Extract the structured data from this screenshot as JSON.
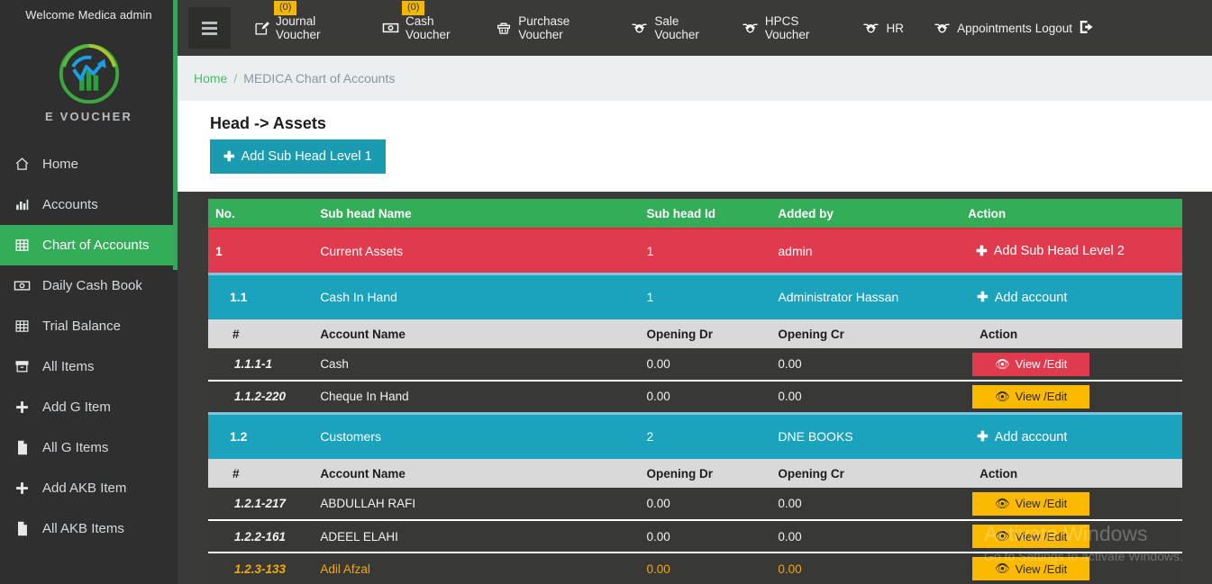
{
  "sidebar": {
    "welcome": "Welcome Medica admin",
    "logo_text": "E VOUCHER",
    "items": [
      {
        "label": "Home",
        "icon": "home-icon",
        "active": false
      },
      {
        "label": "Accounts",
        "icon": "bar-chart-icon",
        "active": false
      },
      {
        "label": "Chart of Accounts",
        "icon": "grid-icon",
        "active": true
      },
      {
        "label": "Daily Cash Book",
        "icon": "money-icon",
        "active": false
      },
      {
        "label": "Trial Balance",
        "icon": "grid-icon",
        "active": false
      },
      {
        "label": "All Items",
        "icon": "archive-icon",
        "active": false
      },
      {
        "label": "Add G Item",
        "icon": "plus-icon",
        "active": false
      },
      {
        "label": "All G Items",
        "icon": "file-icon",
        "active": false
      },
      {
        "label": "Add AKB Item",
        "icon": "plus-icon",
        "active": false
      },
      {
        "label": "All AKB Items",
        "icon": "file-icon",
        "active": false
      }
    ]
  },
  "topbar": {
    "menu_toggle": "hamburger-icon",
    "items": [
      {
        "label": "Journal Voucher",
        "icon": "edit-square-icon",
        "badge": "(0)"
      },
      {
        "label": "Cash Voucher",
        "icon": "money-icon",
        "badge": "(0)"
      },
      {
        "label": "Purchase Voucher",
        "icon": "basket-icon",
        "badge": ""
      },
      {
        "label": "Sale Voucher",
        "icon": "handshake-icon",
        "badge": ""
      },
      {
        "label": "HPCS Voucher",
        "icon": "handshake-icon",
        "badge": ""
      },
      {
        "label": "HR",
        "icon": "handshake-icon",
        "badge": ""
      },
      {
        "label": "Appointments",
        "icon": "handshake-icon",
        "badge": ""
      }
    ],
    "logout_label": "Logout"
  },
  "breadcrumb": {
    "home": "Home",
    "separator": "/",
    "current": "MEDICA Chart of Accounts"
  },
  "page": {
    "title": "Head -> Assets",
    "add_sub_head_label": "Add Sub Head Level 1"
  },
  "table": {
    "head_columns": [
      "No.",
      "Sub head Name",
      "Sub head Id",
      "Added by",
      "Action"
    ],
    "account_columns": [
      "#",
      "Account Name",
      "Opening Dr",
      "Opening Cr",
      "Action"
    ],
    "rows": {
      "level1": {
        "no": "1",
        "name": "Current Assets",
        "id": "1",
        "added_by": "admin",
        "action": "Add Sub Head Level 2"
      },
      "group1": {
        "no": "1.1",
        "name": "Cash In Hand",
        "id": "1",
        "added_by": "Administrator Hassan",
        "action": "Add account"
      },
      "group1_accounts": [
        {
          "no": "1.1.1-1",
          "name": "Cash",
          "dr": "0.00",
          "cr": "0.00",
          "action": "View /Edit",
          "style": "red"
        },
        {
          "no": "1.1.2-220",
          "name": "Cheque In Hand",
          "dr": "0.00",
          "cr": "0.00",
          "action": "View /Edit",
          "style": "amber"
        }
      ],
      "group2": {
        "no": "1.2",
        "name": "Customers",
        "id": "2",
        "added_by": "DNE BOOKS",
        "action": "Add account"
      },
      "group2_accounts": [
        {
          "no": "1.2.1-217",
          "name": "ABDULLAH RAFI",
          "dr": "0.00",
          "cr": "0.00",
          "action": "View /Edit",
          "style": "amber"
        },
        {
          "no": "1.2.2-161",
          "name": "ADEEL ELAHI",
          "dr": "0.00",
          "cr": "0.00",
          "action": "View /Edit",
          "style": "amber"
        },
        {
          "no": "1.2.3-133",
          "name": "Adil Afzal",
          "dr": "0.00",
          "cr": "0.00",
          "action": "View /Edit",
          "style": "amber"
        }
      ]
    }
  },
  "watermark": {
    "line1": "Activate Windows",
    "line2": "Go to Settings to activate Windows."
  },
  "colors": {
    "sidebar_bg": "#2f2f2f",
    "accent_green": "#34ad58",
    "level1_red": "#e03a4e",
    "level2_teal": "#1ba2bc",
    "button_teal": "#1a9bb0",
    "amber": "#fbba00",
    "topbar_bg": "#3a3a38"
  }
}
